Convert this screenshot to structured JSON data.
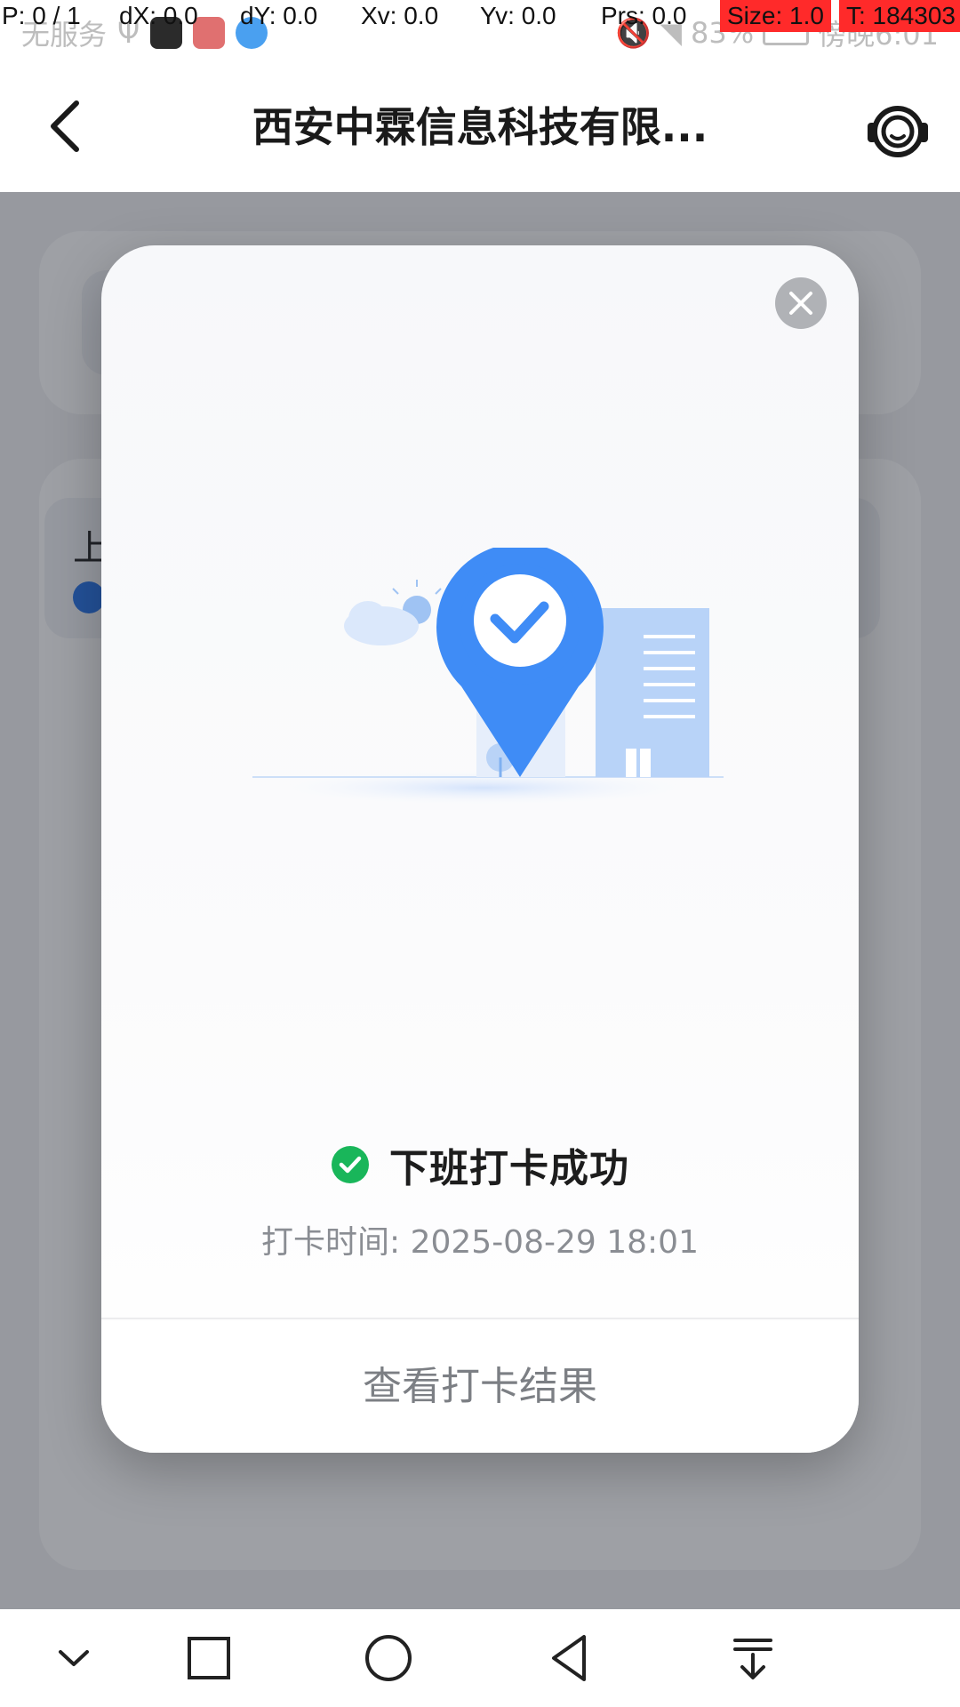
{
  "status_bar": {
    "carrier": "无服务",
    "battery": "83%",
    "time": "傍晚6:01"
  },
  "debug_overlay": {
    "p": "P: 0 / 1",
    "dx": "dX: 0.0",
    "dy": "dY: 0.0",
    "xv": "Xv: 0.0",
    "yv": "Yv: 0.0",
    "prs": "Prs: 0.0",
    "size": "Size: 1.0",
    "t": "T: 184303"
  },
  "header": {
    "title": "西安中霖信息科技有限..."
  },
  "background": {
    "partial_label": "上"
  },
  "modal": {
    "success_text": "下班打卡成功",
    "punch_time": "打卡时间: 2025-08-29 18:01",
    "view_result": "查看打卡结果"
  },
  "colors": {
    "accent_blue": "#3f8cf6",
    "success_green": "#19b65a"
  },
  "icons": {
    "back": "back-arrow-icon",
    "service": "customer-service-icon",
    "close": "close-icon",
    "success": "check-circle-icon"
  }
}
